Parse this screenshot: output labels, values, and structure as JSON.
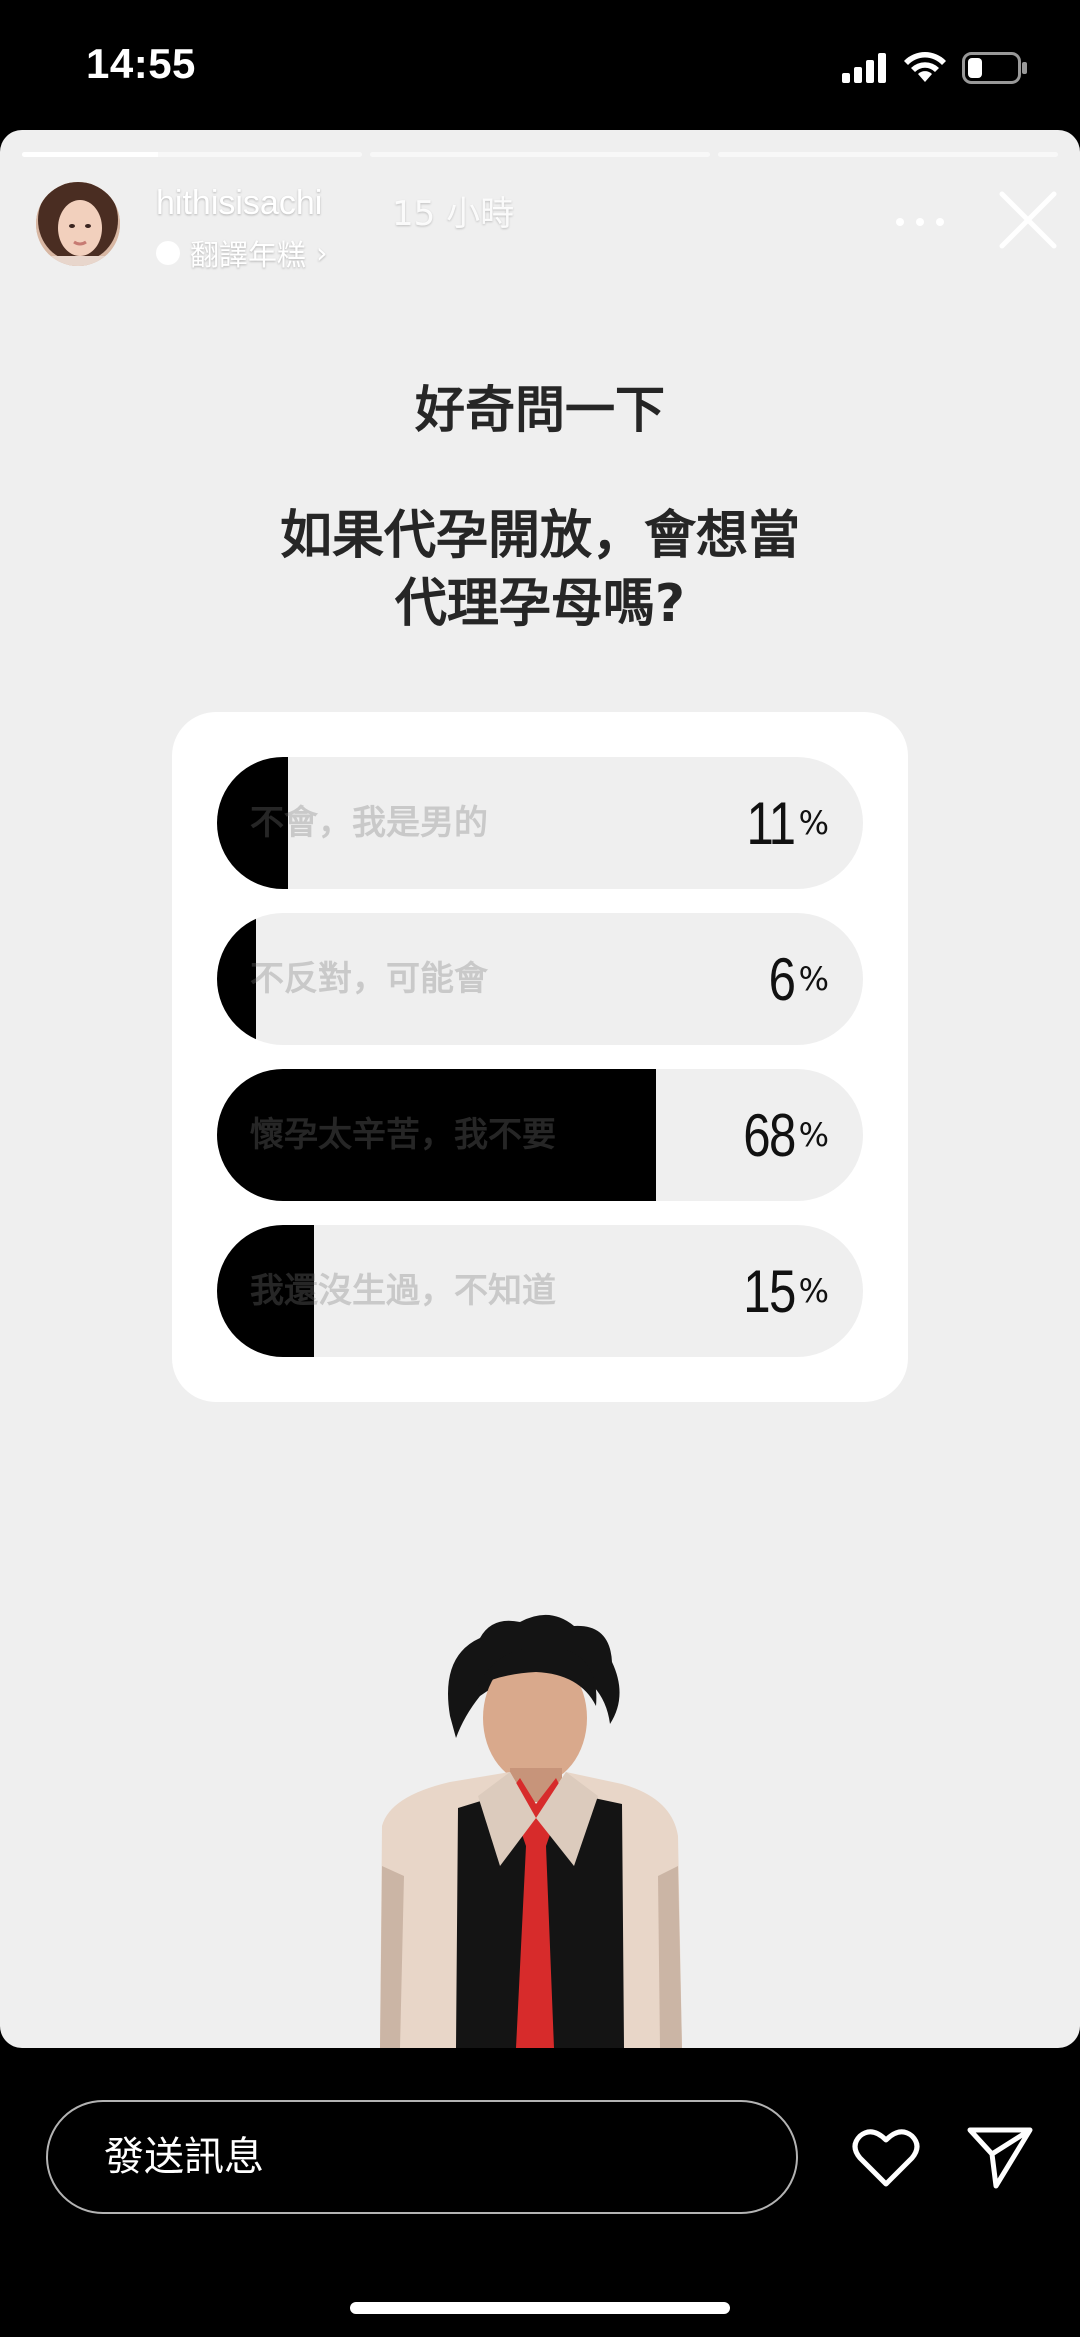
{
  "status_bar": {
    "time": "14:55"
  },
  "story": {
    "progress": [
      0.4,
      0,
      0
    ],
    "username": "hithisisachi",
    "time_ago": "15 小時",
    "translate_label": "翻譯年糕",
    "translate_chevron": "›"
  },
  "content": {
    "title": "好奇問一下",
    "question_lines": [
      "如果代孕開放，會想當",
      "代理孕母嗎?"
    ]
  },
  "poll": {
    "options": [
      {
        "label": "不會，我是男的",
        "percent": 11
      },
      {
        "label": "不反對，可能會",
        "percent": 6
      },
      {
        "label": "懷孕太辛苦，我不要",
        "percent": 68
      },
      {
        "label": "我還沒生過，不知道",
        "percent": 15
      }
    ],
    "percent_sign": "%"
  },
  "footer": {
    "message_placeholder": "發送訊息"
  },
  "colors": {
    "story_bg": "#efefef",
    "poll_bar": "#000000",
    "text": "#262626"
  }
}
